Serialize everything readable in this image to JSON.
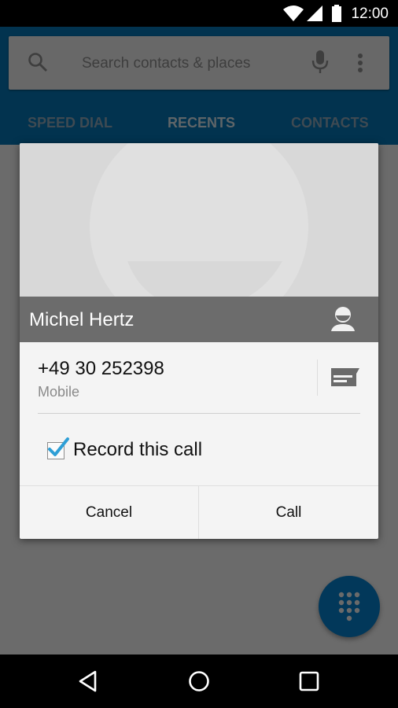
{
  "status_bar": {
    "time": "12:00",
    "icons": [
      "wifi-icon",
      "signal-icon",
      "battery-icon"
    ]
  },
  "search": {
    "placeholder": "Search contacts & places",
    "icons": [
      "search-icon",
      "microphone-icon",
      "more-vert-icon"
    ]
  },
  "tabs": [
    {
      "label": "SPEED DIAL",
      "active": false
    },
    {
      "label": "RECENTS",
      "active": true
    },
    {
      "label": "CONTACTS",
      "active": false
    }
  ],
  "dialog": {
    "contact_name": "Michel Hertz",
    "contact_icon": "contact-card-icon",
    "phone_number": "+49 30 252398",
    "phone_type": "Mobile",
    "message_icon": "message-icon",
    "record_label": "Record this call",
    "record_checked": true,
    "cancel_label": "Cancel",
    "call_label": "Call"
  },
  "fab": {
    "icon": "dialpad-icon"
  },
  "nav_bar": {
    "icons": [
      "back-icon",
      "home-icon",
      "recents-icon"
    ]
  },
  "colors": {
    "primary": "#02334f",
    "accent": "#2e9fd6",
    "dim_scrim": "#6b6b6b"
  }
}
